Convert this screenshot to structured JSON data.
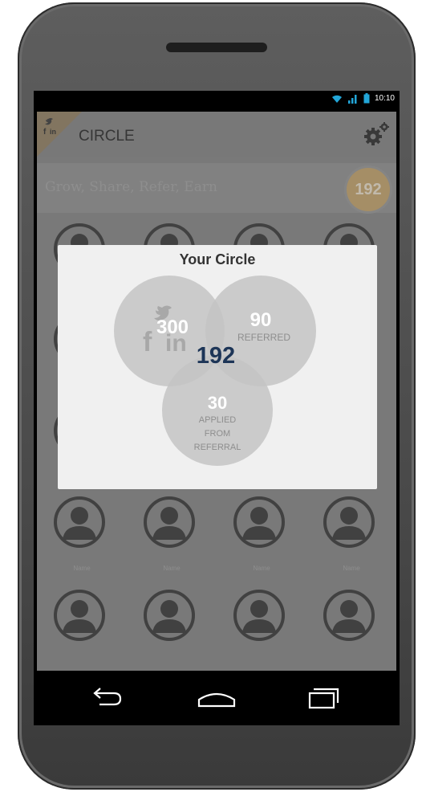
{
  "status": {
    "time": "10:10"
  },
  "app": {
    "title": "CIRCLE",
    "tagline": "Grow, Share, Refer, Earn",
    "badge_count": "192"
  },
  "grid": {
    "name_label": "Name"
  },
  "dialog": {
    "title": "Your Circle",
    "total": "192",
    "social": {
      "count": "300"
    },
    "referred": {
      "count": "90",
      "label": "REFERRED"
    },
    "applied": {
      "count": "30",
      "label_lines": [
        "APPLIED",
        "FROM",
        "REFERRAL"
      ]
    }
  },
  "icons": {
    "logo": "twitter-linkedin-facebook-logo-icon",
    "settings": "gear-icon",
    "back": "back-arrow-icon",
    "home": "home-icon",
    "recents": "recent-apps-icon"
  },
  "colors": {
    "total_number": "#1d3557",
    "circle_fill": "#c4c4c4",
    "dialog_bg": "#f0f0f0"
  }
}
